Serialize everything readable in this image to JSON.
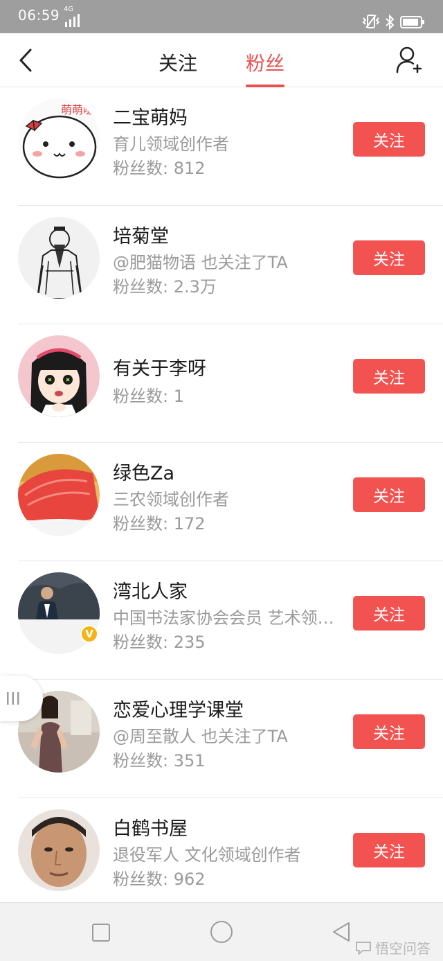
{
  "status_bar": {
    "time": "06:59",
    "network": "4G"
  },
  "tabs": [
    {
      "label": "关注"
    },
    {
      "label": "粉丝",
      "active": true
    }
  ],
  "accent_color": "#f25350",
  "users": [
    {
      "name": "二宝萌妈",
      "desc": "育儿领域创作者",
      "fans": "粉丝数: 812",
      "avatar_text": "萌萌哒",
      "button": "关注"
    },
    {
      "name": "培菊堂",
      "desc": "@肥猫物语 也关注了TA",
      "fans": "粉丝数: 2.3万",
      "button": "关注"
    },
    {
      "name": "有关于李呀",
      "fans": "粉丝数: 1",
      "button": "关注"
    },
    {
      "name": "绿色Za",
      "desc": "三农领域创作者",
      "fans": "粉丝数: 172",
      "button": "关注"
    },
    {
      "name": "湾北人家",
      "desc": "中国书法家协会会员 艺术领…",
      "fans": "粉丝数: 235",
      "badge": "V",
      "button": "关注"
    },
    {
      "name": "恋爱心理学课堂",
      "desc": "@周至散人 也关注了TA",
      "fans": "粉丝数: 351",
      "button": "关注"
    },
    {
      "name": "白鹤书屋",
      "desc": "退役军人 文化领域创作者",
      "fans": "粉丝数: 962",
      "button": "关注"
    }
  ],
  "watermark": "悟空问答"
}
